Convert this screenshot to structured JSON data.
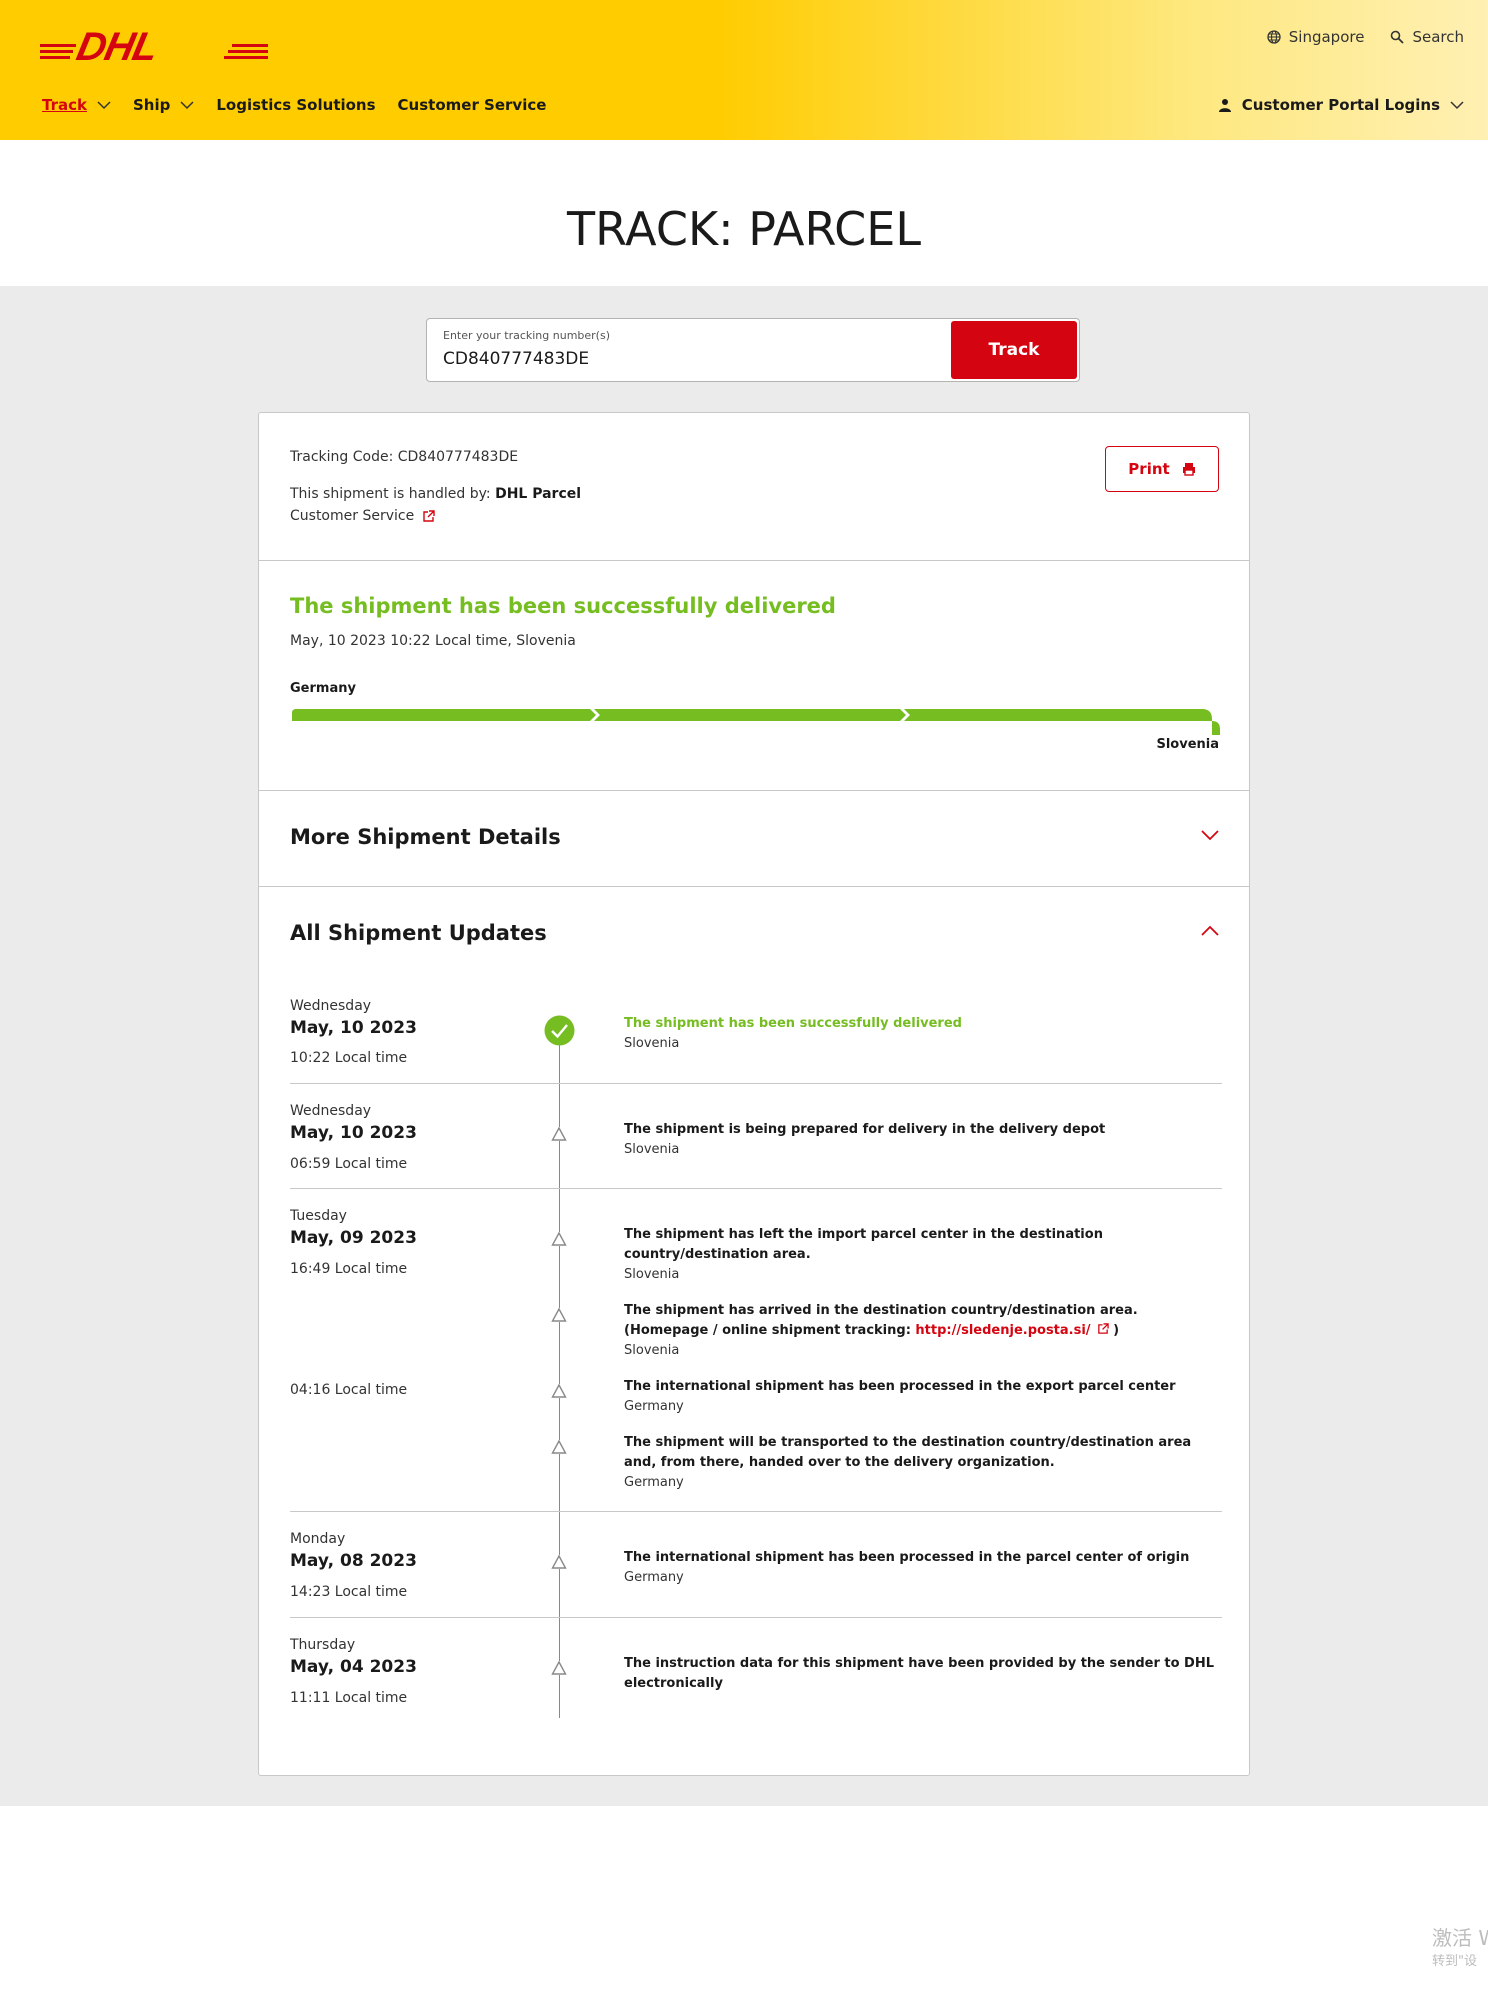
{
  "header": {
    "brand": "DHL",
    "country": "Singapore",
    "search_label": "Search",
    "nav": [
      {
        "label": "Track",
        "active": true,
        "has_dropdown": true
      },
      {
        "label": "Ship",
        "active": false,
        "has_dropdown": true
      },
      {
        "label": "Logistics Solutions",
        "active": false,
        "has_dropdown": false
      },
      {
        "label": "Customer Service",
        "active": false,
        "has_dropdown": false
      }
    ],
    "portal_label": "Customer Portal Logins"
  },
  "page_title": "TRACK: PARCEL",
  "search": {
    "label": "Enter your tracking number(s)",
    "value": "CD840777483DE",
    "button": "Track"
  },
  "summary": {
    "tracking_code": "Tracking Code: CD840777483DE",
    "handled_prefix": "This shipment is handled by: ",
    "handled_by": "DHL Parcel",
    "customer_service": "Customer Service",
    "print": "Print"
  },
  "status": {
    "headline": "The shipment has been successfully delivered",
    "when": "May, 10 2023 10:22 Local time, Slovenia",
    "origin": "Germany",
    "destination": "Slovenia",
    "progress": 1.0
  },
  "more_details": {
    "title": "More Shipment Details"
  },
  "updates": {
    "title": "All Shipment Updates",
    "groups": [
      {
        "day": "Wednesday",
        "date": "May, 10 2023",
        "time": "10:22 Local time",
        "events": [
          {
            "text": "The shipment has been successfully delivered",
            "location": "Slovenia",
            "delivered": true
          }
        ]
      },
      {
        "day": "Wednesday",
        "date": "May, 10 2023",
        "time": "06:59 Local time",
        "events": [
          {
            "text": "The shipment is being prepared for delivery in the delivery depot",
            "location": "Slovenia"
          }
        ]
      },
      {
        "day": "Tuesday",
        "date": "May, 09 2023",
        "time": "16:49 Local time",
        "events": [
          {
            "text": "The shipment has left the import parcel center in the destination country/destination area.",
            "location": "Slovenia"
          },
          {
            "text_before": "The shipment has arrived in the destination country/destination area. (Homepage / online shipment tracking: ",
            "link": "http://sledenje.posta.si/",
            "text_after": " )",
            "location": "Slovenia"
          }
        ],
        "time2": "04:16 Local time",
        "events2": [
          {
            "text": "The international shipment has been processed in the export parcel center",
            "location": "Germany"
          },
          {
            "text": "The shipment will be transported to the destination country/destination area and, from there, handed over to the delivery organization.",
            "location": "Germany"
          }
        ]
      },
      {
        "day": "Monday",
        "date": "May, 08 2023",
        "time": "14:23 Local time",
        "events": [
          {
            "text": "The international shipment has been processed in the parcel center of origin",
            "location": "Germany"
          }
        ]
      },
      {
        "day": "Thursday",
        "date": "May, 04 2023",
        "time": "11:11 Local time",
        "events": [
          {
            "text": "The instruction data for this shipment have been provided by the sender to DHL electronically",
            "location": ""
          }
        ]
      }
    ]
  },
  "watermark": {
    "line1": "激活 W",
    "line2": "转到\"设"
  },
  "colors": {
    "brand_yellow": "#ffcc00",
    "brand_red": "#d40511",
    "success_green": "#76bd22"
  }
}
